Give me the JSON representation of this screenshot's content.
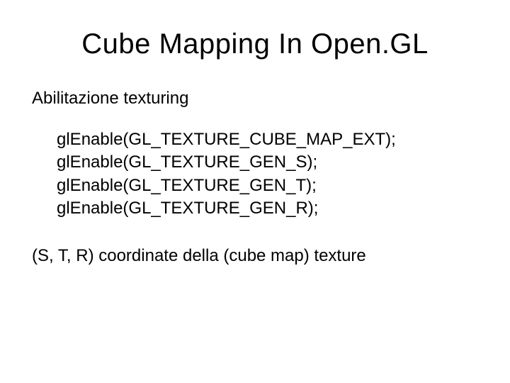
{
  "title": "Cube Mapping In Open.GL",
  "section": "Abilitazione texturing",
  "code": {
    "line1": "glEnable(GL_TEXTURE_CUBE_MAP_EXT);",
    "line2": "glEnable(GL_TEXTURE_GEN_S);",
    "line3": "glEnable(GL_TEXTURE_GEN_T);",
    "line4": "glEnable(GL_TEXTURE_GEN_R);"
  },
  "footer": "(S, T, R) coordinate della (cube map) texture"
}
